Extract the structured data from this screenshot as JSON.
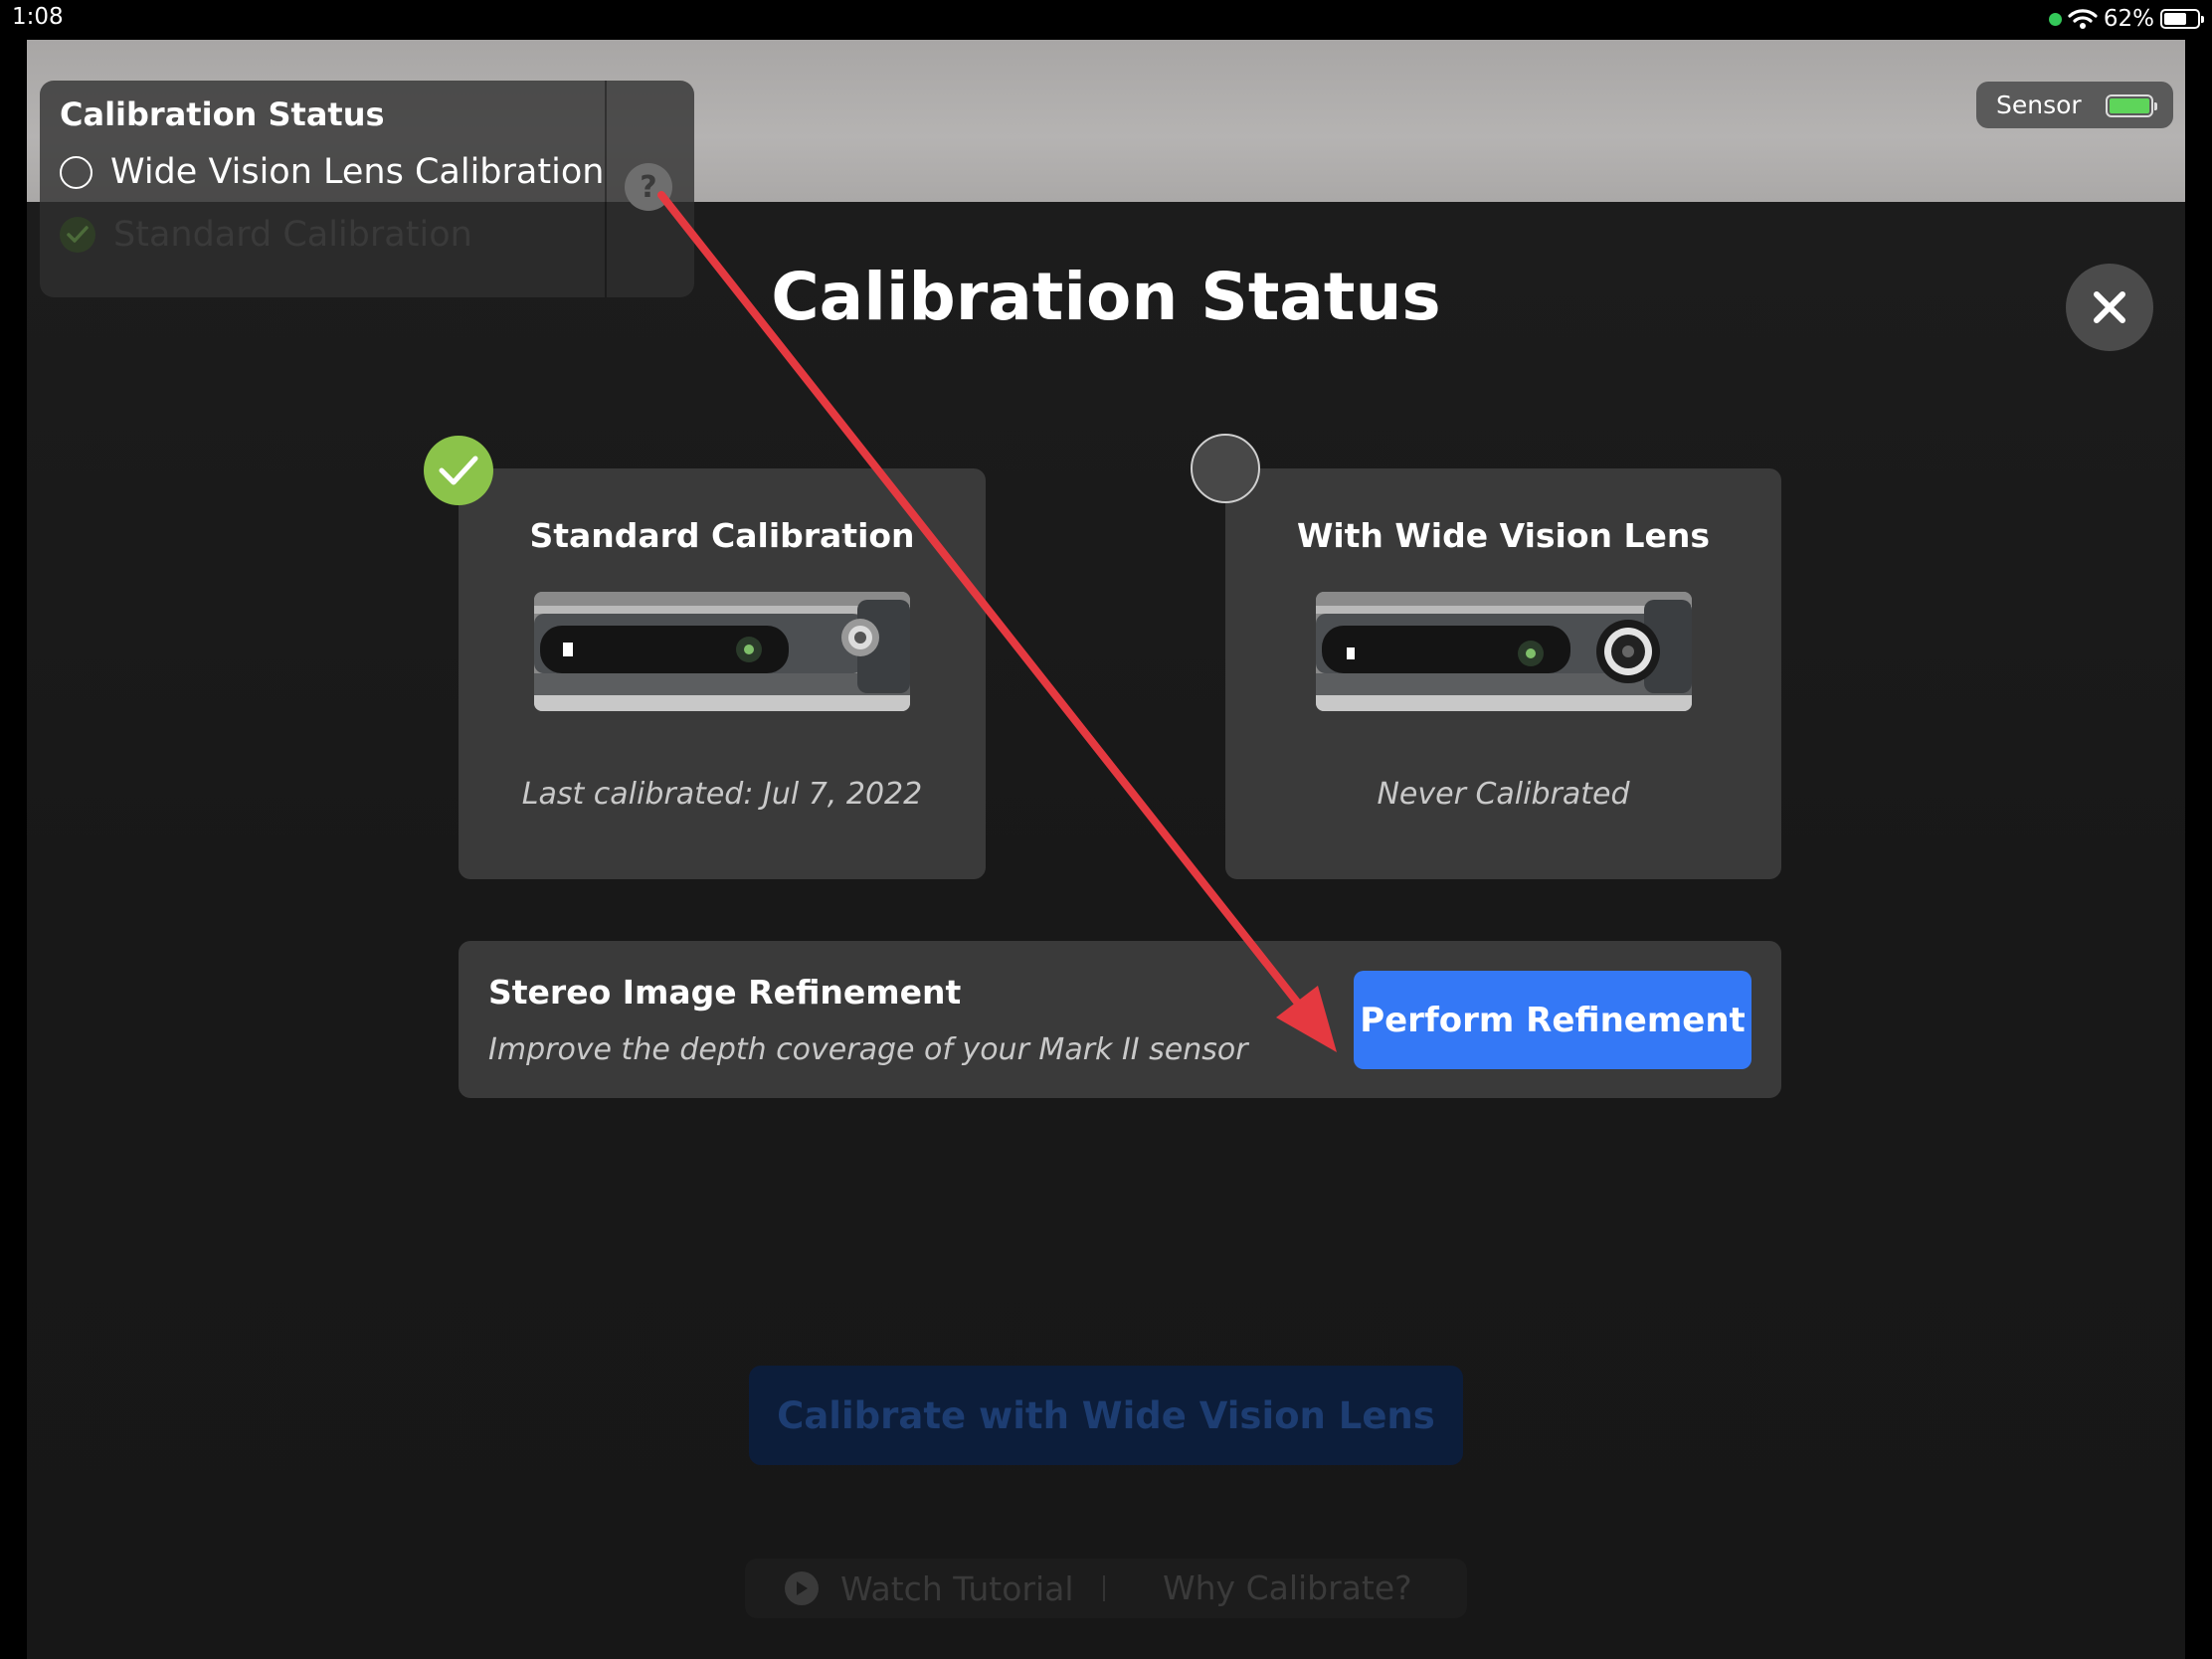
{
  "status_bar": {
    "time": "1:08",
    "battery": "62%"
  },
  "sensor_badge": {
    "label": "Sensor"
  },
  "mini_panel": {
    "title": "Calibration Status",
    "items": [
      {
        "label": "Wide Vision Lens Calibration",
        "state": "unchecked"
      },
      {
        "label": "Standard Calibration",
        "state": "checked"
      }
    ],
    "help_label": "?"
  },
  "modal": {
    "title": "Calibration Status",
    "cards": [
      {
        "title": "Standard Calibration",
        "status": "Last calibrated: Jul 7, 2022",
        "badge": "check-icon"
      },
      {
        "title": "With Wide Vision Lens",
        "status": "Never Calibrated",
        "badge": "empty-circle"
      }
    ],
    "refinement": {
      "title": "Stereo Image Refinement",
      "subtitle": "Improve the depth coverage of your Mark II sensor",
      "button_label": "Perform Refinement"
    }
  },
  "calibrate_button": {
    "label": "Calibrate with Wide Vision Lens"
  },
  "bottom_links": {
    "watch_tutorial": "Watch Tutorial",
    "why_calibrate": "Why Calibrate?"
  },
  "colors": {
    "accent": "#3478f6",
    "success": "#8bc34a",
    "annotation_arrow": "#e53940",
    "background": "#161616"
  }
}
